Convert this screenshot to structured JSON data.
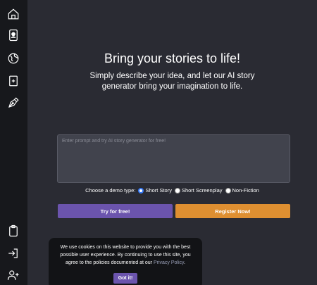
{
  "sidebar": {
    "top_icons": [
      "home-icon",
      "profile-card-icon",
      "globe-icon",
      "add-page-icon",
      "pen-nib-icon"
    ],
    "bottom_icons": [
      "clipboard-icon",
      "sign-in-icon",
      "add-user-icon"
    ]
  },
  "hero": {
    "title": "Bring your stories to life!",
    "subtitle": "Simply describe your idea, and let our AI story generator bring your imagination to life."
  },
  "prompt": {
    "placeholder": "Enter prompt and try AI story generator for free!",
    "value": ""
  },
  "demo": {
    "label": "Choose a demo type:",
    "options": [
      {
        "label": "Short Story",
        "checked": true
      },
      {
        "label": "Short Screenplay",
        "checked": false
      },
      {
        "label": "Non-Fiction",
        "checked": false
      }
    ]
  },
  "buttons": {
    "try_label": "Try for free!",
    "register_label": "Register Now!"
  },
  "cookie": {
    "text": "We use cookies on this website to provide you with the best possible user experience. By continuing to use this site, you agree to the policies documented at our ",
    "link_label": "Privacy Policy",
    "tail": ".",
    "button_label": "Got it!"
  },
  "colors": {
    "background": "#2a2b33",
    "sidebar": "#17181c",
    "primary": "#6b54ad",
    "accent": "#de8f31"
  }
}
